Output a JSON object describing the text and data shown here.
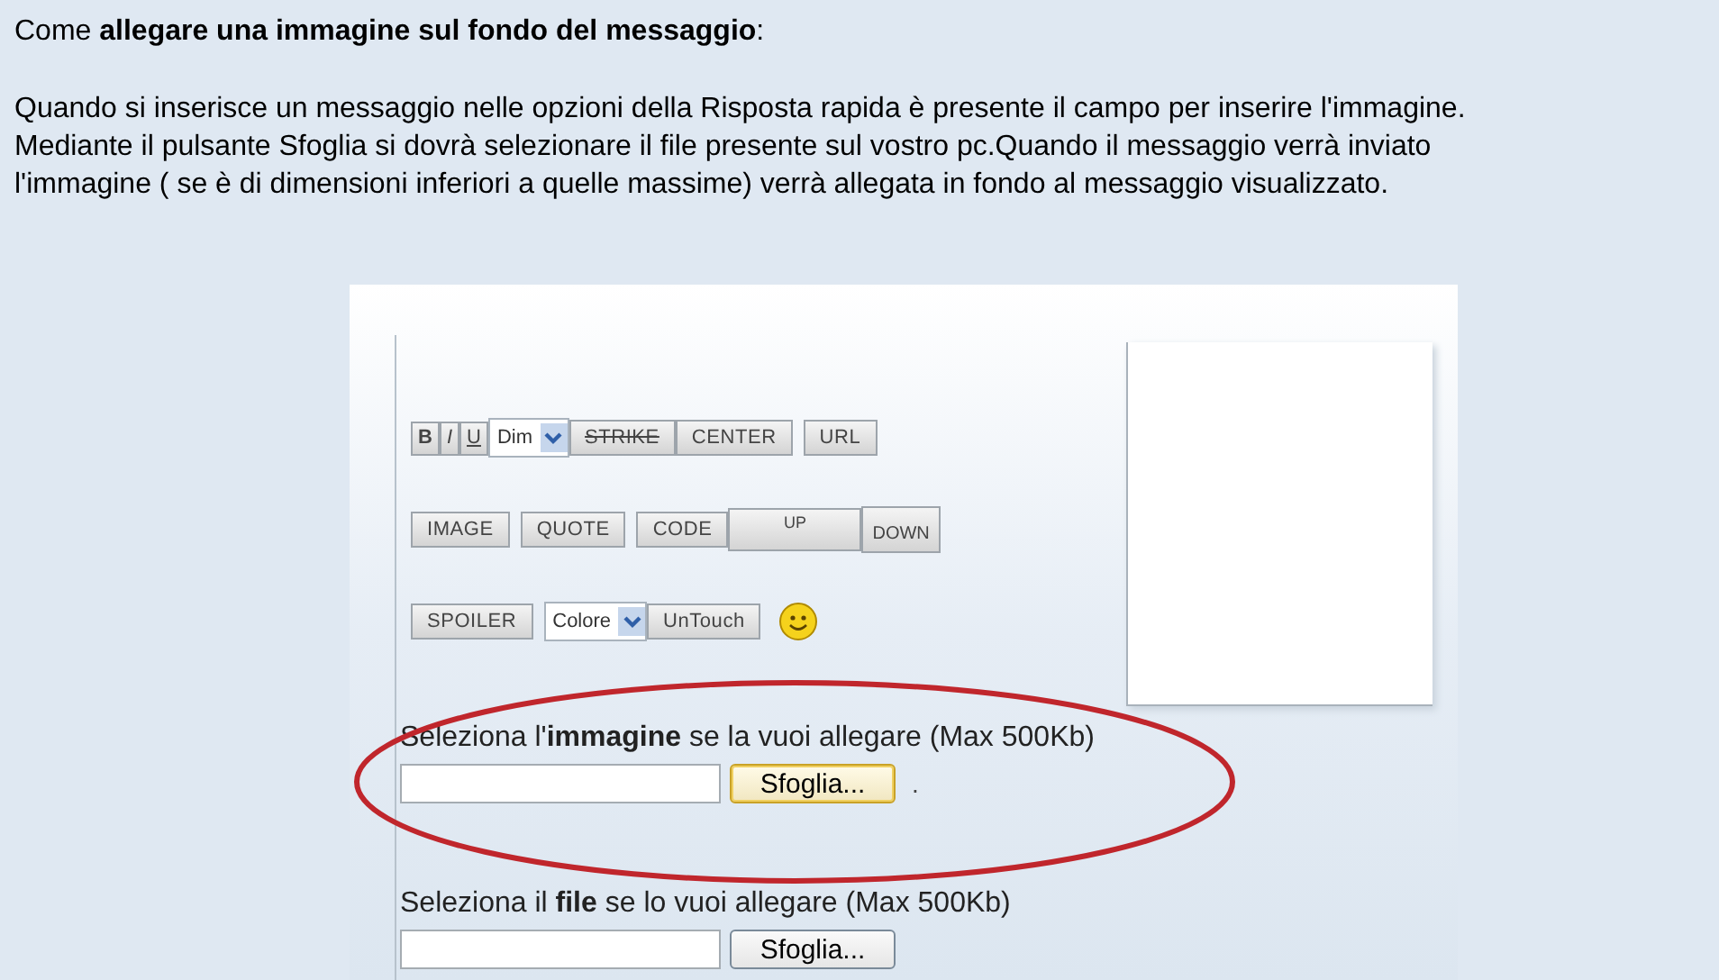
{
  "heading": "Come **allegare una immagine sul fondo del messaggio**:",
  "paragraph_lines": [
    "Quando si inserisce un messaggio nelle opzioni della Risposta rapida è presente il campo per inserire l'immagine.",
    "Mediante il pulsante Sfoglia si dovrà selezionare il file presente sul vostro pc.Quando il messaggio verrà inviato",
    "l'immagine ( se è di dimensioni inferiori a quelle massime) verrà allegata in fondo al messaggio visualizzato."
  ],
  "screenshot": {
    "toolbar_rows": [
      [
        {
          "kind": "button",
          "label": "B"
        },
        {
          "kind": "button",
          "label": "I"
        },
        {
          "kind": "button",
          "label": "U"
        },
        {
          "kind": "select",
          "label": "Dim"
        },
        {
          "kind": "button",
          "label": "STRIKE"
        },
        {
          "kind": "button",
          "label": "CENTER"
        },
        {
          "kind": "gap"
        },
        {
          "kind": "button",
          "label": "URL"
        }
      ],
      [
        {
          "kind": "button",
          "label": "IMAGE"
        },
        {
          "kind": "gap"
        },
        {
          "kind": "button",
          "label": "QUOTE"
        },
        {
          "kind": "gap"
        },
        {
          "kind": "button",
          "label": "CODE"
        },
        {
          "kind": "button",
          "label": "UP"
        },
        {
          "kind": "button",
          "label": "DOWN"
        }
      ],
      [
        {
          "kind": "button",
          "label": "SPOILER"
        },
        {
          "kind": "gap"
        },
        {
          "kind": "select",
          "label": "Colore"
        },
        {
          "kind": "button",
          "label": "UnTouch"
        },
        {
          "kind": "gap"
        },
        {
          "kind": "smiley"
        }
      ]
    ],
    "uploads": [
      {
        "label": "Seleziona l'**immagine** se la vuoi allegare (Max 500Kb)",
        "button": "Sfoglia...",
        "focused": true,
        "suffix": "."
      },
      {
        "label": "Seleziona il **file** se lo vuoi allegare (Max 500Kb)",
        "button": "Sfoglia...",
        "focused": false
      }
    ]
  }
}
